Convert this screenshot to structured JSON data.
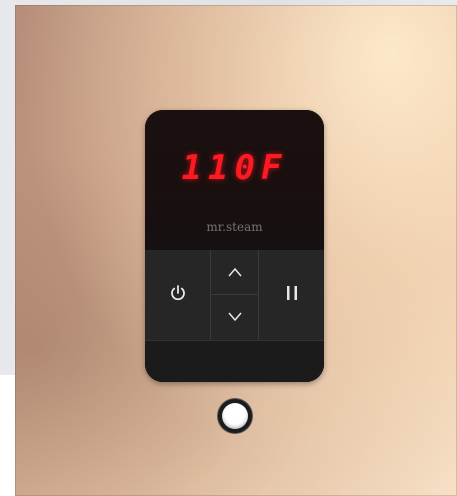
{
  "display": {
    "temperature": "110F",
    "brand": "mr.steam"
  },
  "buttons": {
    "power": {
      "icon": "power-icon"
    },
    "up": {
      "icon": "chevron-up-icon"
    },
    "down": {
      "icon": "chevron-down-icon"
    },
    "pause": {
      "icon": "pause-icon"
    }
  },
  "colors": {
    "led_red": "#ff1a22",
    "panel_black": "#141414",
    "plate_bronze": "#d4ae93"
  }
}
